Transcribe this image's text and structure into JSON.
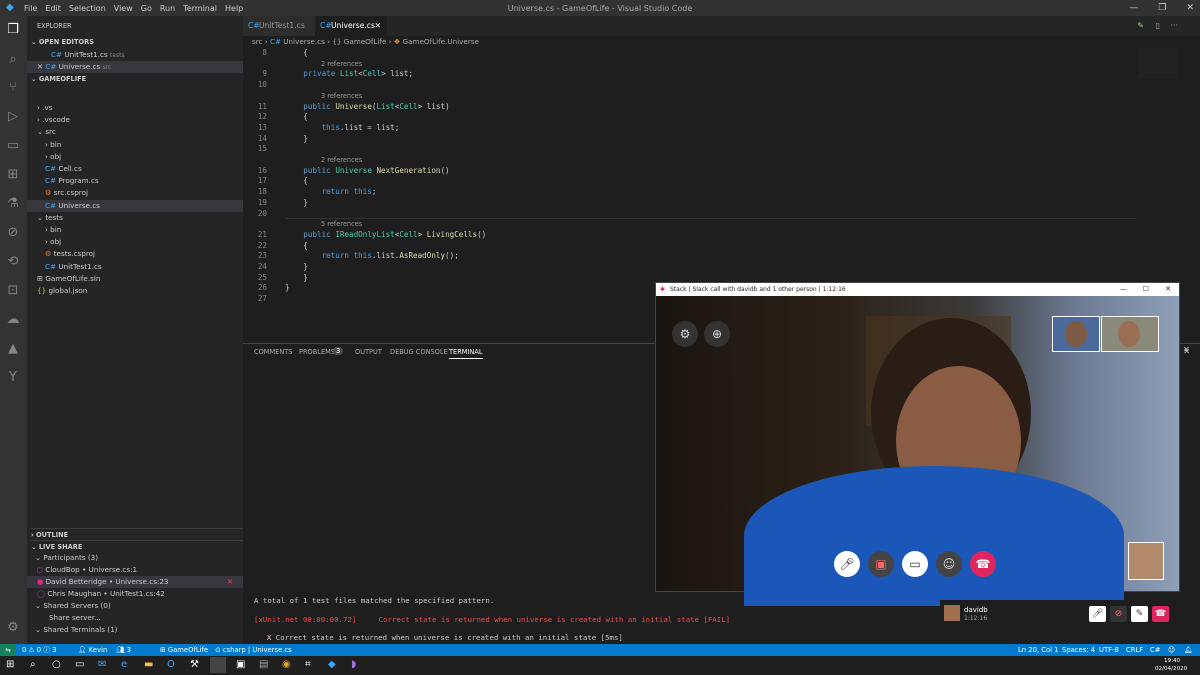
{
  "titlebar": {
    "menu": [
      "File",
      "Edit",
      "Selection",
      "View",
      "Go",
      "Run",
      "Terminal",
      "Help"
    ],
    "title": "Universe.cs - GameOfLife - Visual Studio Code"
  },
  "sidebar": {
    "explorer_title": "EXPLORER",
    "open_editors_title": "OPEN EDITORS",
    "open_editors": [
      {
        "name": "UnitTest1.cs",
        "folder": "tests"
      },
      {
        "name": "Universe.cs",
        "folder": "src"
      }
    ],
    "project_title": "GAMEOFLIFE",
    "tree": [
      ".vs",
      ".vscode",
      "src",
      "bin",
      "obj",
      "Cell.cs",
      "Program.cs",
      "src.csproj",
      "Universe.cs",
      "tests",
      "bin",
      "obj",
      "tests.csproj",
      "UnitTest1.cs",
      "GameOfLife.sln",
      "global.json"
    ],
    "outline_title": "OUTLINE",
    "liveshare_title": "LIVE SHARE",
    "participants_label": "Participants (3)",
    "participants": [
      {
        "name": "CloudBop",
        "file": "Universe.cs:1"
      },
      {
        "name": "David Betteridge",
        "file": "Universe.cs:23"
      },
      {
        "name": "Chris Maughan",
        "file": "UnitTest1.cs:42"
      }
    ],
    "shared_servers": "Shared Servers (0)",
    "share_server": "Share server...",
    "shared_terminals": "Shared Terminals (1)"
  },
  "tabs": [
    {
      "label": "UnitTest1.cs",
      "active": false
    },
    {
      "label": "Universe.cs",
      "active": true
    }
  ],
  "breadcrumb": [
    "src",
    "Universe.cs",
    "{} GameOfLife",
    "GameOfLife.Universe"
  ],
  "code": [
    {
      "n": "8",
      "text": "    {"
    },
    {
      "ref": "2 references"
    },
    {
      "n": "9",
      "text": "    private List<Cell> list;"
    },
    {
      "n": "10",
      "text": ""
    },
    {
      "ref": "3 references"
    },
    {
      "n": "11",
      "text": "    public Universe(List<Cell> list)"
    },
    {
      "n": "12",
      "text": "    {"
    },
    {
      "n": "13",
      "text": "        this.list = list;"
    },
    {
      "n": "14",
      "text": "    }"
    },
    {
      "n": "15",
      "text": ""
    },
    {
      "ref": "2 references"
    },
    {
      "n": "16",
      "text": "    public Universe NextGeneration()"
    },
    {
      "n": "17",
      "text": "    {"
    },
    {
      "n": "18",
      "text": "        return this;"
    },
    {
      "n": "19",
      "text": "    }"
    },
    {
      "n": "20",
      "text": ""
    },
    {
      "ref": "5 references"
    },
    {
      "n": "21",
      "text": "    public IReadOnlyList<Cell> LivingCells()"
    },
    {
      "n": "22",
      "text": "    {"
    },
    {
      "n": "23",
      "text": "        return this.list.AsReadOnly();"
    },
    {
      "n": "24",
      "text": "    }"
    },
    {
      "n": "25",
      "text": "    }"
    },
    {
      "n": "26",
      "text": "}"
    },
    {
      "n": "27",
      "text": ""
    }
  ],
  "panel": {
    "tabs": [
      "COMMENTS",
      "PROBLEMS",
      "OUTPUT",
      "DEBUG CONSOLE",
      "TERMINAL"
    ],
    "problems_count": "3",
    "terminal_lines": [
      "A total of 1 test files matched the specified pattern.",
      "[xUnit.net 00:00:00.72]     Correct state is returned when universe is created with an initial state [FAIL]",
      "  X Correct state is returned when universe is created with an initial state [5ms]"
    ]
  },
  "statusbar": {
    "left": [
      "0 ⚠ 0 ⓘ 3",
      "Kevin",
      "3",
      "GameOfLife",
      "csharp",
      "Universe.cs"
    ],
    "right": [
      "Ln 20, Col 1",
      "Spaces: 4",
      "UTF-8",
      "CRLF",
      "C#"
    ]
  },
  "taskbar": {
    "time": "19:40",
    "date": "02/04/2020"
  },
  "slack": {
    "title": "Stack | Slack call with davidb and 1 other person | 1:12:16",
    "caller_name": "davidb",
    "call_time": "1:12:16"
  },
  "colors": {
    "accent": "#007acc",
    "error": "#f14c4c",
    "slack_hangup": "#e0245e"
  }
}
